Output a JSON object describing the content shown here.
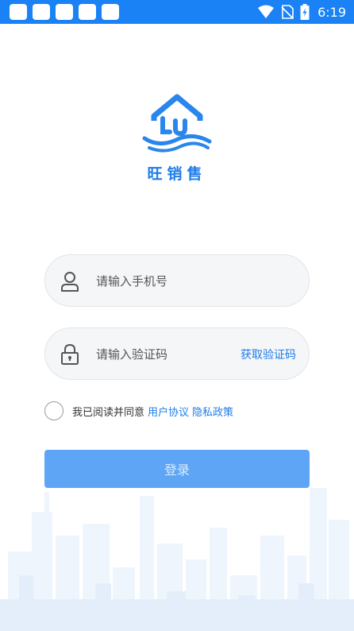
{
  "status_bar": {
    "time": "6:19",
    "notification_icons": [
      "app-icon",
      "app-icon",
      "app-icon",
      "app-icon",
      "app-icon"
    ],
    "status_icons": [
      "wifi-icon",
      "no-sim-icon",
      "battery-charging-icon"
    ]
  },
  "brand": {
    "logo_icon": "house-wave-logo",
    "name": "旺销售"
  },
  "login_form": {
    "phone_placeholder": "请输入手机号",
    "code_placeholder": "请输入验证码",
    "get_code_label": "获取验证码",
    "agreement_prefix": "我已阅读并同意",
    "user_agreement": "用户协议",
    "privacy_policy": "隐私政策",
    "submit_label": "登录"
  },
  "colors": {
    "primary": "#1a82f5",
    "button": "#5ea6f5",
    "field_bg": "#f4f6f8",
    "link": "#1e7ce8"
  }
}
